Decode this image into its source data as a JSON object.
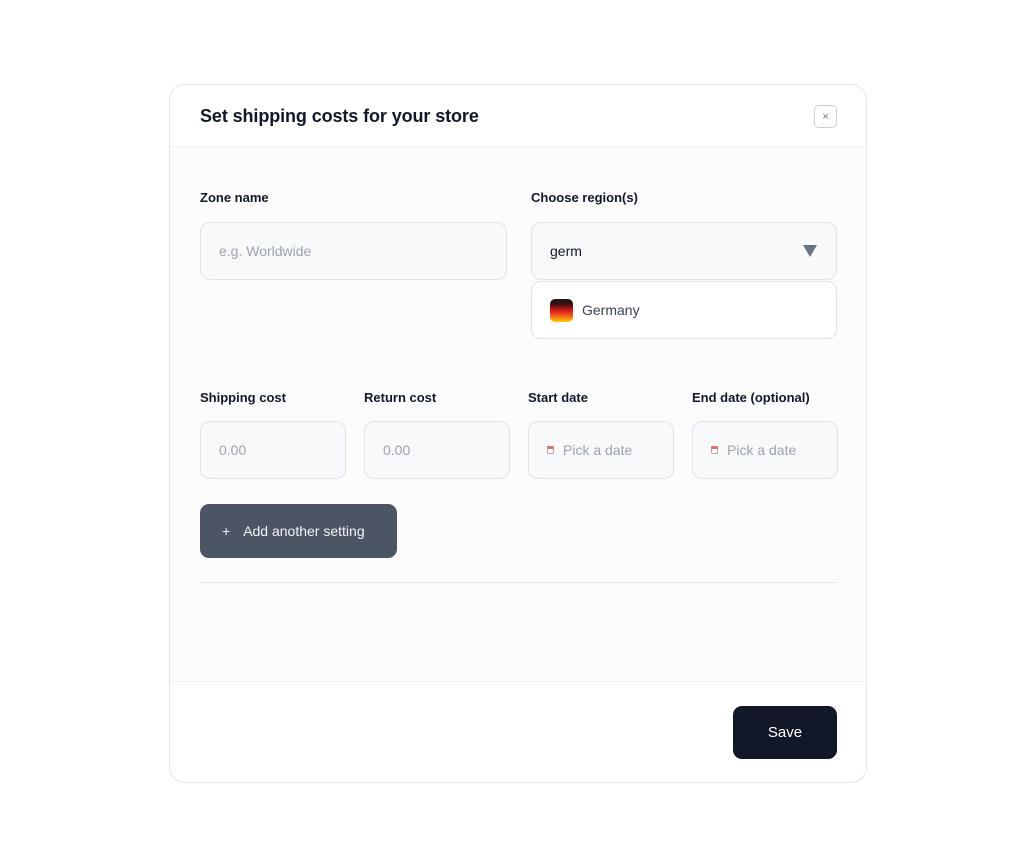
{
  "modal": {
    "title": "Set shipping costs for your store",
    "close_glyph": "×"
  },
  "zone": {
    "label": "Zone name",
    "placeholder": "e.g. Worldwide",
    "value": ""
  },
  "region": {
    "label": "Choose region(s)",
    "value": "germ",
    "options": [
      {
        "label": "Germany",
        "icon": "germany-flag-icon"
      }
    ]
  },
  "shipping_cost": {
    "label": "Shipping cost",
    "placeholder": "0.00"
  },
  "return_cost": {
    "label": "Return cost",
    "placeholder": "0.00"
  },
  "start_date": {
    "label": "Start date",
    "placeholder": "Pick a date",
    "icon": "calendar-icon"
  },
  "end_date": {
    "label": "End date (optional)",
    "placeholder": "Pick a date",
    "icon": "calendar-icon"
  },
  "actions": {
    "add_label": "Add another setting",
    "add_icon": "+",
    "save_label": "Save"
  },
  "colors": {
    "primary_button": "#111827",
    "secondary_button": "#4b5563",
    "input_bg": "#f8f9fa",
    "border": "#dfe2e6"
  }
}
